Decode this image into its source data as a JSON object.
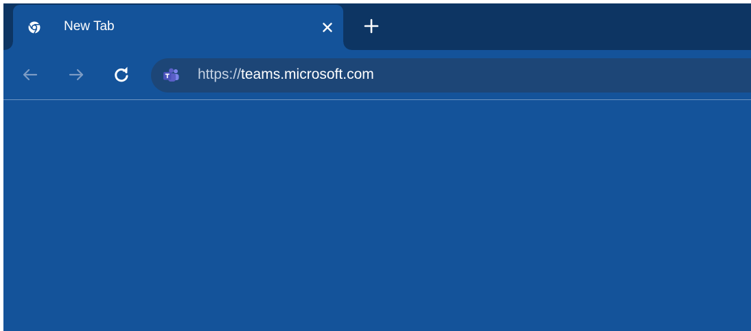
{
  "tab": {
    "title": "New Tab",
    "icon": "chrome-icon",
    "close_icon": "close-icon"
  },
  "tabstrip": {
    "new_tab_icon": "plus-icon"
  },
  "toolbar": {
    "back_icon": "arrow-left-icon",
    "forward_icon": "arrow-right-icon",
    "reload_icon": "reload-icon"
  },
  "omnibox": {
    "site_icon": "microsoft-teams-icon",
    "url_scheme": "https://",
    "url_host": "teams.microsoft.com"
  },
  "colors": {
    "frame": "#0d3563",
    "active_tab": "#14539a",
    "omnibox": "#1d4677",
    "content": "#14539a",
    "teams_purple": "#5b5fc7"
  }
}
